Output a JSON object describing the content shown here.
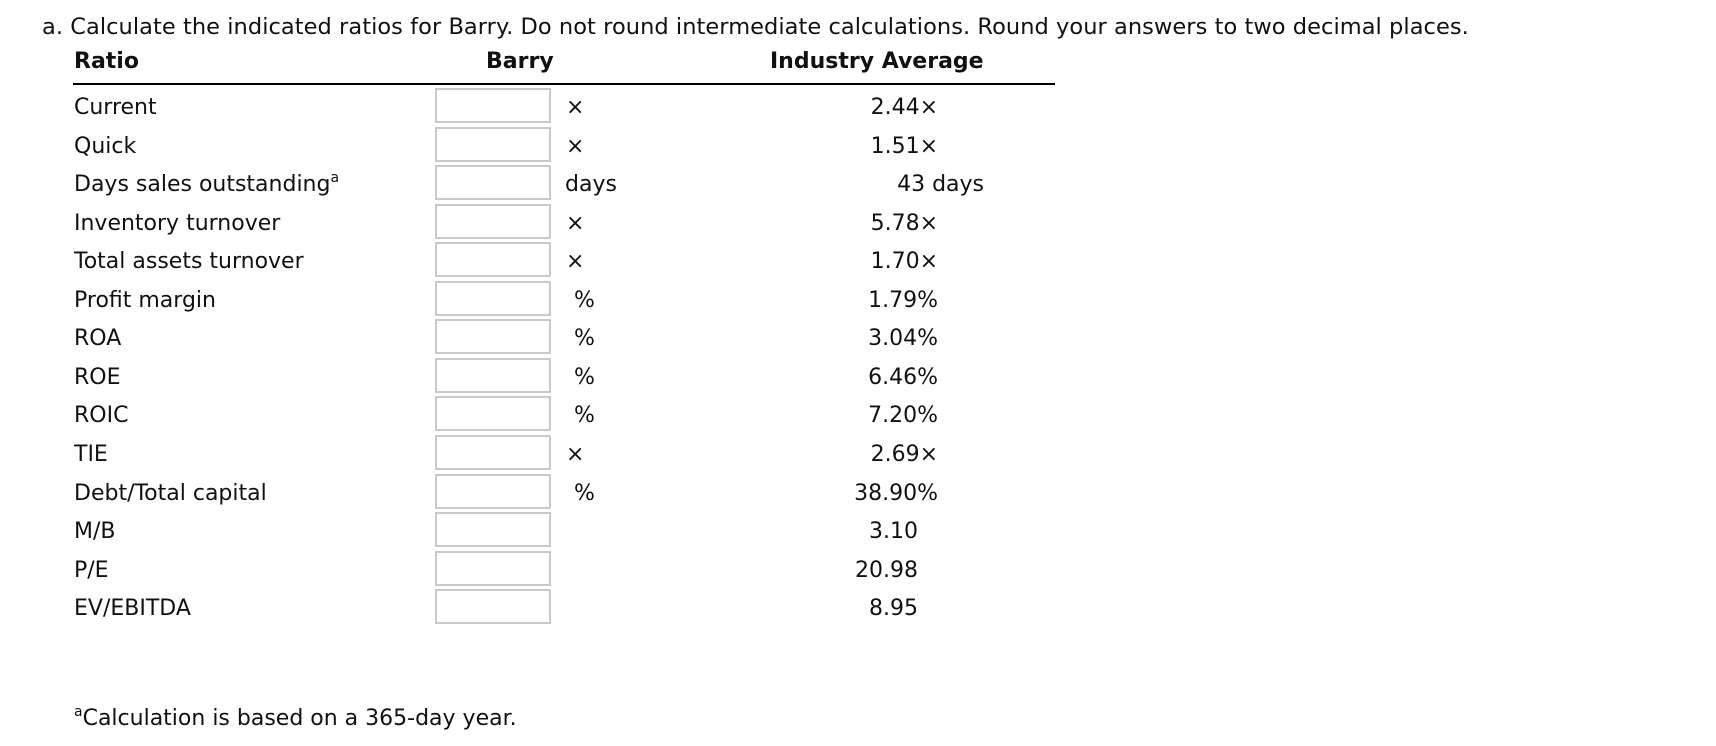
{
  "instruction": "a. Calculate the indicated ratios for Barry. Do not round intermediate calculations. Round your answers to two decimal places.",
  "table": {
    "headers": {
      "ratio": "Ratio",
      "company": "Barry",
      "industry": "Industry Average"
    },
    "rows": [
      {
        "label": "Current",
        "footnote_mark": "",
        "value": "",
        "unit": "×",
        "industry": "2.44×"
      },
      {
        "label": "Quick",
        "footnote_mark": "",
        "value": "",
        "unit": "×",
        "industry": "1.51×"
      },
      {
        "label": "Days sales outstanding",
        "footnote_mark": "a",
        "value": "",
        "unit": "days",
        "industry": "43 days"
      },
      {
        "label": "Inventory turnover",
        "footnote_mark": "",
        "value": "",
        "unit": "×",
        "industry": "5.78×"
      },
      {
        "label": "Total assets turnover",
        "footnote_mark": "",
        "value": "",
        "unit": "×",
        "industry": "1.70×"
      },
      {
        "label": "Profit margin",
        "footnote_mark": "",
        "value": "",
        "unit": "%",
        "industry": "1.79%"
      },
      {
        "label": "ROA",
        "footnote_mark": "",
        "value": "",
        "unit": "%",
        "industry": "3.04%"
      },
      {
        "label": "ROE",
        "footnote_mark": "",
        "value": "",
        "unit": "%",
        "industry": "6.46%"
      },
      {
        "label": "ROIC",
        "footnote_mark": "",
        "value": "",
        "unit": "%",
        "industry": "7.20%"
      },
      {
        "label": "TIE",
        "footnote_mark": "",
        "value": "",
        "unit": "×",
        "industry": "2.69×"
      },
      {
        "label": "Debt/Total capital",
        "footnote_mark": "",
        "value": "",
        "unit": "%",
        "industry": "38.90%"
      },
      {
        "label": "M/B",
        "footnote_mark": "",
        "value": "",
        "unit": "",
        "industry": "3.10"
      },
      {
        "label": "P/E",
        "footnote_mark": "",
        "value": "",
        "unit": "",
        "industry": "20.98"
      },
      {
        "label": "EV/EBITDA",
        "footnote_mark": "",
        "value": "",
        "unit": "",
        "industry": "8.95"
      }
    ]
  },
  "footnote": {
    "mark": "a",
    "text": "Calculation is based on a 365-day year."
  }
}
